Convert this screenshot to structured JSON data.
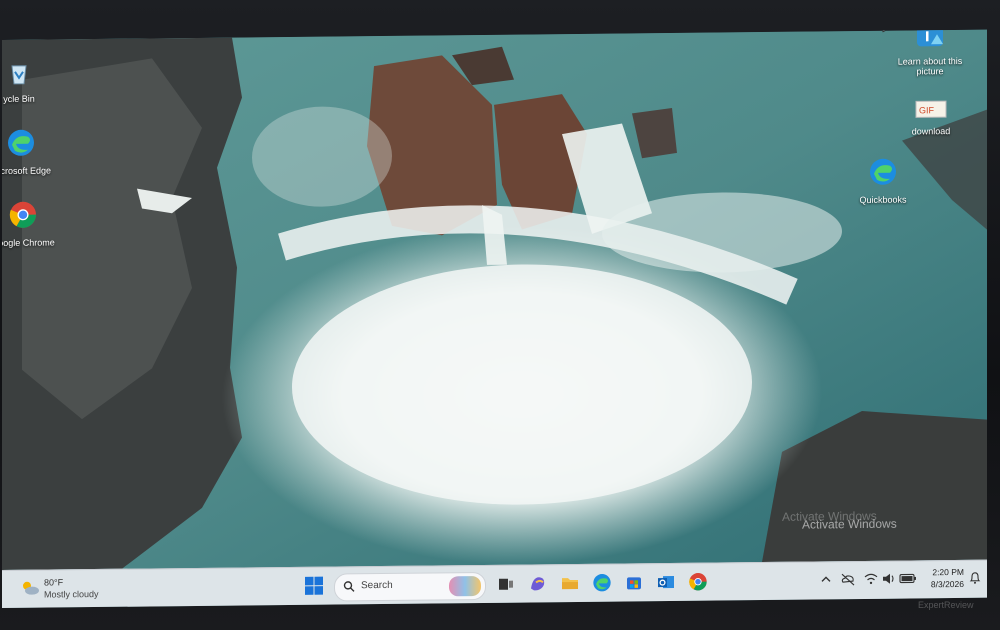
{
  "desktop": {
    "icons_left": [
      {
        "label": "ycle Bin",
        "icon": "recycle-bin-icon"
      },
      {
        "label": "Microsoft Edge",
        "icon": "edge-icon"
      },
      {
        "label": "Google Chrome",
        "icon": "chrome-icon"
      }
    ],
    "icons_right": [
      {
        "label": "Learn about this picture",
        "icon": "info-picture-icon"
      },
      {
        "label": "download",
        "icon": "gif-file-icon"
      },
      {
        "label": "Quickbooks",
        "icon": "edge-icon"
      }
    ],
    "activation_watermark": "Activate Windows"
  },
  "taskbar": {
    "weather": {
      "temp": "80°F",
      "condition": "Mostly cloudy"
    },
    "search_label": "Search",
    "pinned_icons": [
      "windows-start-icon",
      "task-view-icon",
      "copilot-icon",
      "file-explorer-icon",
      "edge-icon",
      "microsoft-store-icon",
      "outlook-icon",
      "chrome-icon"
    ],
    "tray_icons": [
      "chevron-up-icon",
      "cloud-off-icon",
      "wifi-icon",
      "speaker-icon",
      "battery-icon",
      "notification-icon"
    ],
    "time": "2:20 PM",
    "date": "8/3/2026"
  },
  "photo_watermark": "ExpertReview",
  "colors": {
    "accent": "#0078d4",
    "taskbar_bg": "#e8ecf0"
  }
}
